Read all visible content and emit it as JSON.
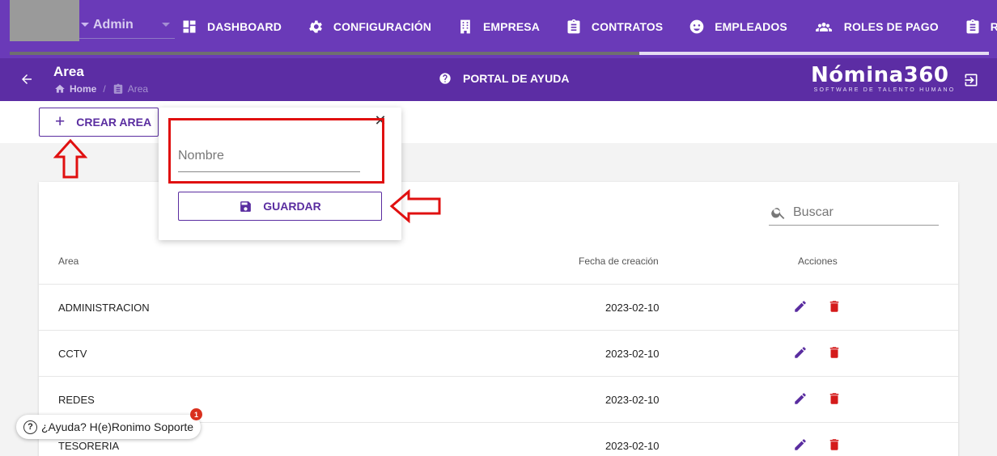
{
  "topnav": {
    "user_label": "Admin",
    "items": [
      {
        "label": "DASHBOARD",
        "icon": "dashboard-icon"
      },
      {
        "label": "CONFIGURACIÓN",
        "icon": "gear-icon"
      },
      {
        "label": "EMPRESA",
        "icon": "building-icon"
      },
      {
        "label": "CONTRATOS",
        "icon": "clipboard-icon"
      },
      {
        "label": "EMPLEADOS",
        "icon": "face-icon"
      },
      {
        "label": "ROLES DE PAGO",
        "icon": "group-icon"
      },
      {
        "label": "REPORTES",
        "icon": "clipboard-icon"
      }
    ]
  },
  "header": {
    "title": "Area",
    "breadcrumb_home": "Home",
    "breadcrumb_sep": "/",
    "breadcrumb_current": "Area",
    "help_portal": "PORTAL DE AYUDA",
    "brand_name": "Nómina360",
    "brand_tagline": "SOFTWARE DE TALENTO HUMANO"
  },
  "toolbar": {
    "create_label": "CREAR AREA"
  },
  "popover": {
    "name_placeholder": "Nombre",
    "save_label": "GUARDAR",
    "close_glyph": "✕"
  },
  "table": {
    "search_placeholder": "Buscar",
    "headers": {
      "area": "Area",
      "fecha": "Fecha de creación",
      "acciones": "Acciones"
    },
    "rows": [
      {
        "area": "ADMINISTRACION",
        "fecha": "2023-02-10"
      },
      {
        "area": "CCTV",
        "fecha": "2023-02-10"
      },
      {
        "area": "REDES",
        "fecha": "2023-02-10"
      },
      {
        "area": "TESORERIA",
        "fecha": "2023-02-10"
      }
    ]
  },
  "help_chip": {
    "label": "¿Ayuda? H(e)Ronimo Soporte",
    "badge": "1"
  },
  "colors": {
    "nav_bg": "#6a3ab8",
    "header_bg": "#5c2da4",
    "accent": "#5a2da0",
    "delete": "#d41a1a",
    "annotation": "#e01010"
  }
}
